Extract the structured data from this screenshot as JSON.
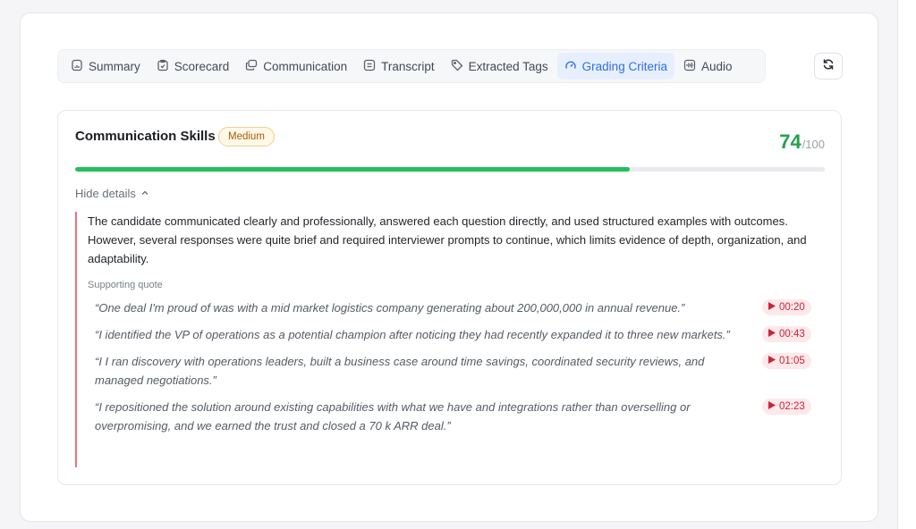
{
  "tabs": [
    {
      "label": "Summary",
      "icon": "summary-icon",
      "active": false
    },
    {
      "label": "Scorecard",
      "icon": "scorecard-icon",
      "active": false
    },
    {
      "label": "Communication",
      "icon": "communication-icon",
      "active": false
    },
    {
      "label": "Transcript",
      "icon": "transcript-icon",
      "active": false
    },
    {
      "label": "Extracted Tags",
      "icon": "tag-icon",
      "active": false
    },
    {
      "label": "Grading Criteria",
      "icon": "gauge-icon",
      "active": true
    },
    {
      "label": "Audio",
      "icon": "audio-icon",
      "active": false
    }
  ],
  "criterion": {
    "title": "Communication Skills",
    "badge": "Medium",
    "score": "74",
    "score_max": "/100",
    "progress_fraction": 0.74,
    "toggle_label": "Hide details",
    "summary": "The candidate communicated clearly and professionally, answered each question directly, and used structured examples with outcomes. However, several responses were quite brief and required interviewer prompts to continue, which limits evidence of depth, organization, and adaptability.",
    "quote_label": "Supporting quote",
    "quotes": [
      {
        "text": "“One deal I'm proud of was with a mid market logistics company generating about 200,000,000 in annual revenue.”",
        "time": "00:20"
      },
      {
        "text": "“I identified the VP of operations as a potential champion after noticing they had recently expanded it to three new markets.”",
        "time": "00:43"
      },
      {
        "text": "“I I ran discovery with operations leaders, built a business case around time savings, coordinated security reviews, and managed negotiations.”",
        "time": "01:05"
      },
      {
        "text": "“I repositioned the solution around existing capabilities with what we have and integrations rather than overselling or overpromising, and we earned the trust and closed a 70 k ARR deal.”",
        "time": "02:23"
      }
    ]
  },
  "colors": {
    "accent": "#2f6fe4",
    "score": "#22a04e",
    "progress": "#22c05a",
    "timestamp": "#c9263a",
    "badge_text": "#a35c0a"
  }
}
